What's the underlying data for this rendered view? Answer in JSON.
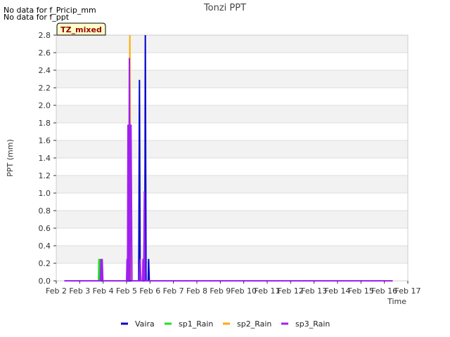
{
  "notices": [
    "No data for f_Pricip_mm",
    "No data for f_ppt"
  ],
  "badge": "TZ_mixed",
  "colors": {
    "Vaira": "#0000cc",
    "sp1_Rain": "#22dd22",
    "sp2_Rain": "#ffaa00",
    "sp3_Rain": "#a020f0",
    "band": "#f2f2f2",
    "grid": "#dddddd",
    "badge_bg": "#ffffcc",
    "badge_text": "#990000"
  },
  "chart_data": {
    "type": "line",
    "title": "Tonzi PPT",
    "xlabel": "Time",
    "ylabel": "PPT (mm)",
    "xlim": [
      2,
      17
    ],
    "ylim": [
      0,
      2.8
    ],
    "x_ticks": [
      {
        "v": 2,
        "label": "Feb 2"
      },
      {
        "v": 3,
        "label": "Feb 3"
      },
      {
        "v": 4,
        "label": "Feb 4"
      },
      {
        "v": 5,
        "label": "Feb 5"
      },
      {
        "v": 6,
        "label": "Feb 6"
      },
      {
        "v": 7,
        "label": "Feb 7"
      },
      {
        "v": 8,
        "label": "Feb 8"
      },
      {
        "v": 9,
        "label": "Feb 9"
      },
      {
        "v": 10,
        "label": "Feb 10"
      },
      {
        "v": 11,
        "label": "Feb 11"
      },
      {
        "v": 12,
        "label": "Feb 12"
      },
      {
        "v": 13,
        "label": "Feb 13"
      },
      {
        "v": 14,
        "label": "Feb 14"
      },
      {
        "v": 15,
        "label": "Feb 15"
      },
      {
        "v": 16,
        "label": "Feb 16"
      },
      {
        "v": 17,
        "label": "Feb 17"
      }
    ],
    "y_ticks": [
      0.0,
      0.2,
      0.4,
      0.6,
      0.8,
      1.0,
      1.2,
      1.4,
      1.6,
      1.8,
      2.0,
      2.2,
      2.4,
      2.6,
      2.8
    ],
    "grid": true,
    "legend": "bottom",
    "series": [
      {
        "name": "Vaira",
        "points": [
          [
            2.35,
            0
          ],
          [
            5.52,
            0
          ],
          [
            5.55,
            2.29
          ],
          [
            5.58,
            0
          ],
          [
            5.78,
            0
          ],
          [
            5.8,
            2.8
          ],
          [
            5.83,
            0
          ],
          [
            5.92,
            0
          ],
          [
            5.94,
            0.25
          ],
          [
            5.97,
            0
          ],
          [
            16.35,
            0
          ]
        ]
      },
      {
        "name": "sp1_Rain",
        "points": [
          [
            2.35,
            0
          ],
          [
            3.8,
            0
          ],
          [
            3.82,
            0.25
          ],
          [
            3.85,
            0
          ],
          [
            3.88,
            0.25
          ],
          [
            3.91,
            0
          ],
          [
            5.06,
            0
          ],
          [
            5.09,
            0.25
          ],
          [
            5.12,
            0
          ],
          [
            16.35,
            0
          ]
        ]
      },
      {
        "name": "sp2_Rain",
        "points": [
          [
            2.35,
            0
          ],
          [
            5.1,
            0
          ],
          [
            5.14,
            2.8
          ],
          [
            5.18,
            0
          ],
          [
            5.55,
            0
          ],
          [
            5.58,
            0.25
          ],
          [
            5.61,
            0
          ],
          [
            5.76,
            0
          ],
          [
            5.79,
            1.27
          ],
          [
            5.82,
            0
          ],
          [
            16.35,
            0
          ]
        ]
      },
      {
        "name": "sp3_Rain",
        "points": [
          [
            2.35,
            0
          ],
          [
            3.88,
            0
          ],
          [
            3.91,
            0.25
          ],
          [
            3.93,
            0
          ],
          [
            3.96,
            0.25
          ],
          [
            3.99,
            0
          ],
          [
            5.0,
            0
          ],
          [
            5.02,
            0.25
          ],
          [
            5.04,
            0
          ],
          [
            5.06,
            1.78
          ],
          [
            5.09,
            0
          ],
          [
            5.12,
            2.54
          ],
          [
            5.15,
            0
          ],
          [
            5.19,
            1.78
          ],
          [
            5.23,
            0
          ],
          [
            5.55,
            0
          ],
          [
            5.58,
            0.25
          ],
          [
            5.61,
            0
          ],
          [
            5.68,
            0
          ],
          [
            5.7,
            0.25
          ],
          [
            5.73,
            0
          ],
          [
            5.76,
            1.02
          ],
          [
            5.79,
            0
          ],
          [
            16.35,
            0
          ]
        ]
      }
    ]
  }
}
